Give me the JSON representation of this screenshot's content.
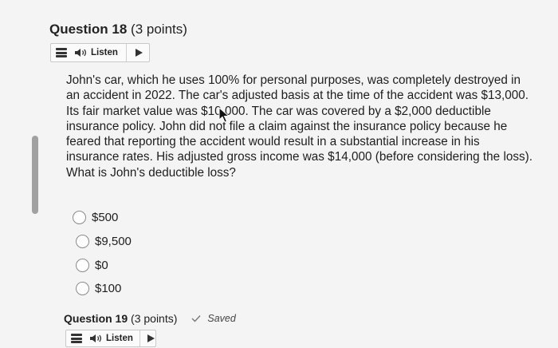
{
  "question18": {
    "title": "Question 18",
    "points": "(3 points)",
    "listen_label": "Listen",
    "text": "John's car, which he uses 100% for personal purposes, was completely destroyed in an accident in 2022. The car's adjusted basis at the time of the accident was $13,000. Its fair market value was $10,000. The car was covered by a $2,000 deductible insurance policy. John did not file a claim against the insurance policy because he feared that reporting the accident would result in a substantial increase in his insurance rates. His adjusted gross income was $14,000 (before considering the loss). What is John's deductible loss?",
    "options": [
      "$500",
      "$9,500",
      "$0",
      "$100"
    ]
  },
  "question19": {
    "title": "Question 19",
    "points": "(3 points)",
    "status": "Saved",
    "listen_label": "Listen"
  },
  "icons": {
    "menu": "menu-icon",
    "speaker": "speaker-icon",
    "play": "play-icon",
    "check": "check-icon",
    "cursor": "mouse-cursor-icon"
  }
}
